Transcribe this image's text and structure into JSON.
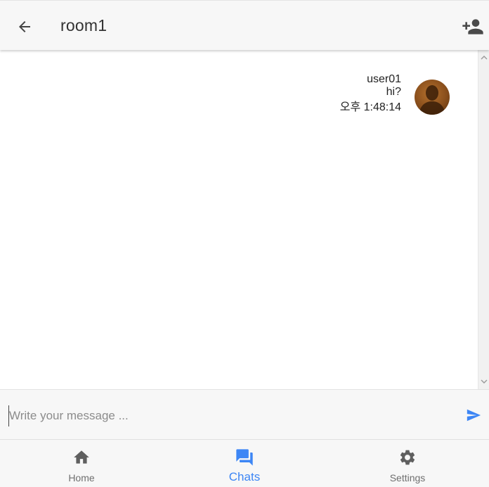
{
  "header": {
    "title": "room1",
    "back_icon": "arrow-back-icon",
    "add_icon": "person-add-icon"
  },
  "messages": [
    {
      "user": "user01",
      "text": "hi?",
      "time": "오후 1:48:14",
      "avatar": "user-avatar"
    }
  ],
  "composer": {
    "placeholder": "Write your message ...",
    "value": "",
    "send_icon": "send-icon"
  },
  "nav": {
    "items": [
      {
        "label": "Home",
        "icon": "home-icon",
        "active": false
      },
      {
        "label": "Chats",
        "icon": "chat-icon",
        "active": true
      },
      {
        "label": "Settings",
        "icon": "gear-icon",
        "active": false
      }
    ]
  },
  "colors": {
    "accent": "#3d86f5",
    "icon": "#5f5f5f",
    "bar_background": "#f7f7f7"
  }
}
